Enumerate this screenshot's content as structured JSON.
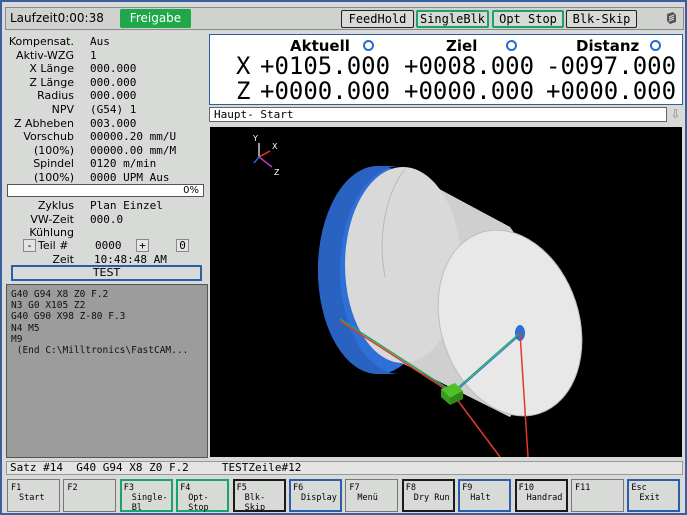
{
  "topbar": {
    "runtime": "Laufzeit0:00:38",
    "status": "Freigabe",
    "buttons": [
      "FeedHold",
      "SingleBlk",
      "Opt Stop",
      "Blk-Skip"
    ]
  },
  "info": {
    "rows": [
      {
        "label": "Kompensat.",
        "value": "Aus"
      },
      {
        "label": "Aktiv-WZG",
        "value": "1"
      },
      {
        "label": "X Länge",
        "value": "000.000"
      },
      {
        "label": "Z Länge",
        "value": "000.000"
      },
      {
        "label": "Radius",
        "value": "000.000"
      },
      {
        "label": "NPV",
        "value": "(G54) 1"
      },
      {
        "label": "Z Abheben",
        "value": "003.000"
      },
      {
        "label": "Vorschub",
        "value": "00000.20 mm/U"
      },
      {
        "label": "(100%)",
        "value": "00000.00 mm/M"
      },
      {
        "label": "Spindel",
        "value": "0120 m/min"
      },
      {
        "label": "(100%)",
        "value": "0000 UPM Aus"
      }
    ],
    "progress": "0%",
    "rows2": [
      {
        "label": "Zyklus",
        "value": "Plan Einzel"
      },
      {
        "label": "VW-Zeit",
        "value": "000.0"
      },
      {
        "label": "Kühlung",
        "value": ""
      }
    ],
    "teil_label": "Teil #",
    "teil_value": "0000",
    "teil_minus": "-",
    "teil_plus": "+",
    "teil_count": "0",
    "zeit_label": "Zeit",
    "zeit_value": "10:48:48 AM",
    "test_button": "TEST"
  },
  "program": {
    "lines": [
      "G40 G94 X8 Z0 F.2",
      "N3 G0 X105 Z2",
      "G40 G90 X98 Z-80 F.3",
      "N4 M5",
      "M9",
      " (End C:\\Milltronics\\FastCAM..."
    ]
  },
  "dro": {
    "headers": [
      "Aktuell",
      "Ziel",
      "Distanz"
    ],
    "axes": [
      {
        "axis": "X",
        "aktuell": "+0105.000",
        "ziel": "+0008.000",
        "distanz": "-0097.000"
      },
      {
        "axis": "Z",
        "aktuell": "+0000.000",
        "ziel": "+0000.000",
        "distanz": "+0000.000"
      }
    ]
  },
  "view_header": "Haupt-  Start",
  "view": {
    "axis_labels": [
      "Y",
      "X",
      "Z"
    ],
    "colors": {
      "stock_end": "#2f6fd8",
      "stock_body": "#d8d8d8",
      "toolpath": "#e23a2a",
      "contour": "#1fa86a",
      "tool": "#4fbf2a"
    }
  },
  "statusline": "Satz #14  G40 G94 X8 Z0 F.2     TESTZeile#12",
  "fkeys": [
    {
      "key": "F1",
      "label": "Start",
      "style": "plain"
    },
    {
      "key": "F2",
      "label": "",
      "style": "plain"
    },
    {
      "key": "F3",
      "label": "Single-Bl",
      "style": "green"
    },
    {
      "key": "F4",
      "label": "Opt-Stop",
      "style": "green"
    },
    {
      "key": "F5",
      "label": "Blk-Skip",
      "style": "dark"
    },
    {
      "key": "F6",
      "label": "Display",
      "style": "blue"
    },
    {
      "key": "F7",
      "label": "Menü",
      "style": "plain"
    },
    {
      "key": "F8",
      "label": "Dry Run",
      "style": "dark"
    },
    {
      "key": "F9",
      "label": "Halt",
      "style": "blue"
    },
    {
      "key": "F10",
      "label": "Handrad",
      "style": "dark"
    },
    {
      "key": "F11",
      "label": "",
      "style": "plain"
    },
    {
      "key": "Esc",
      "label": "Exit",
      "style": "blue"
    }
  ]
}
